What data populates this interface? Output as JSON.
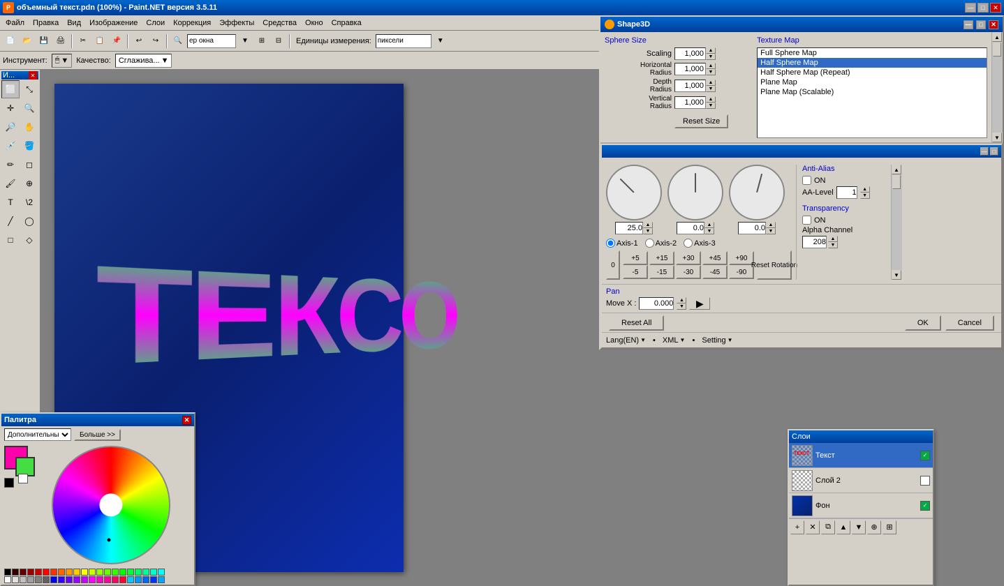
{
  "title_bar": {
    "title": "объемный текст.pdn (100%) - Paint.NET версия 3.5.11",
    "icon": "🎨",
    "min_btn": "—",
    "max_btn": "□",
    "close_btn": "✕"
  },
  "menu": {
    "items": [
      "Файл",
      "Правка",
      "Вид",
      "Изображение",
      "Слои",
      "Коррекция",
      "Эффекты",
      "Средства",
      "Окно",
      "Справка"
    ]
  },
  "toolbar": {
    "units_label": "Единицы измерения:",
    "units_value": "пиксели",
    "zoom_value": "ер окна"
  },
  "tool_options": {
    "tool_label": "Инструмент:",
    "quality_label": "Качество:",
    "quality_value": "Сглажива..."
  },
  "shape3d": {
    "title": "Shape3D",
    "sphere_size": {
      "header": "Sphere Size",
      "scaling_label": "Scaling",
      "scaling_value": "1,000",
      "h_radius_label": "Horizontal Radius",
      "h_radius_value": "1,000",
      "depth_label": "Depth Radius",
      "depth_value": "1,000",
      "v_radius_label": "Vertical Radius",
      "v_radius_value": "1,000",
      "reset_size_btn": "Reset Size"
    },
    "texture_map": {
      "header": "Texture Map",
      "items": [
        "Full Sphere Map",
        "Half Sphere Map",
        "Half Sphere Map (Repeat)",
        "Plane Map",
        "Plane Map (Scalable)"
      ],
      "selected": "Half Sphere Map"
    },
    "rotation": {
      "axis1_label": "Axis-1",
      "axis2_label": "Axis-2",
      "axis3_label": "Axis-3",
      "dial1_value": "25.0",
      "dial2_value": "0.0",
      "dial3_value": "0.0",
      "buttons_plus": [
        "+5",
        "+15",
        "+30",
        "+45",
        "+90"
      ],
      "buttons_minus": [
        "-5",
        "-15",
        "-30",
        "-45",
        "-90"
      ],
      "zero_btn": "0",
      "reset_rotation_btn": "Reset Rotation"
    },
    "anti_alias": {
      "header": "Anti-Alias",
      "on_label": "ON",
      "aa_level_label": "AA-Level",
      "aa_level_value": "1"
    },
    "transparency": {
      "header": "Transparency",
      "on_label": "ON",
      "alpha_label": "Alpha Channel",
      "alpha_value": "208"
    },
    "pan": {
      "header": "Pan",
      "move_x_label": "Move X :",
      "move_x_value": "0.000"
    },
    "bottom": {
      "reset_all_btn": "Reset All",
      "ok_btn": "OK",
      "cancel_btn": "Cancel"
    },
    "lang_bar": {
      "lang": "Lang(EN)",
      "xml": "XML",
      "setting": "Setting"
    }
  },
  "palette": {
    "title": "Палитра",
    "combo_value": "Дополнительны",
    "more_btn": "Больше >>",
    "primary_color": "#ff00aa",
    "secondary_color": "#44dd44"
  },
  "layers": {
    "items": [
      {
        "name": "Текст",
        "checked": true,
        "color": "#00aa44"
      },
      {
        "name": "Слой 2",
        "checked": false,
        "color": "#aaaaaa"
      },
      {
        "name": "Фон",
        "checked": true,
        "color": "#0033aa"
      }
    ]
  }
}
